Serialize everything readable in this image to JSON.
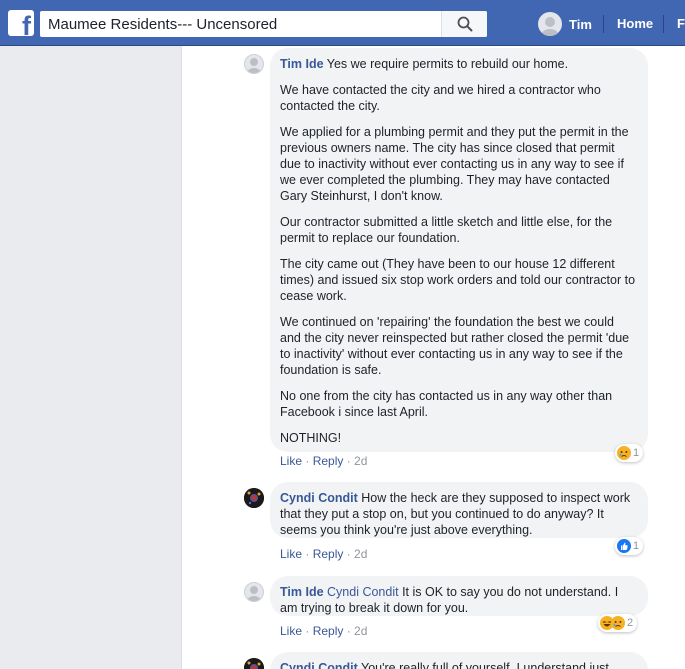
{
  "header": {
    "logo": "f",
    "search_value": "Maumee Residents--- Uncensored",
    "user_name": "Tim",
    "nav_home": "Home",
    "nav_partial": "F"
  },
  "comments": [
    {
      "author": "Tim Ide",
      "paragraphs": [
        "Yes we require permits to rebuild our home.",
        "We have contacted the city and we hired a contractor who contacted the city.",
        "We applied for a plumbing permit and they put the permit in the previous owners name. The city has since closed that permit due to inactivity without ever contacting us in any way to see if we ever completed the plumbing. They may have contacted Gary Steinhurst, I don't know.",
        "Our contractor submitted a little sketch and little else, for the permit to replace our foundation.",
        "The city came out (They have been to our house 12 different times) and issued six stop work orders and told our contractor to cease work.",
        "We continued on 'repairing' the foundation the best we could and the city never reinspected but rather closed the permit 'due to inactivity' without ever contacting us in any way to see if the foundation is safe.",
        "No one from the city has contacted us in any way other than Facebook i since last April.",
        "NOTHING!"
      ],
      "like": "Like",
      "reply": "Reply",
      "time": "2d",
      "reaction_count": "1",
      "reaction_icons": [
        "sad-icon"
      ]
    },
    {
      "author": "Cyndi Condit",
      "text": "How the heck are they supposed to inspect work that they put a stop on, but you continued to do anyway? It seems you think you're just above everything.",
      "like": "Like",
      "reply": "Reply",
      "time": "2d",
      "reaction_count": "1",
      "reaction_icons": [
        "like-icon"
      ]
    },
    {
      "author": "Tim Ide",
      "mention": "Cyndi Condit",
      "text": "It is OK to say you do not understand. I am trying to break it down for you.",
      "like": "Like",
      "reply": "Reply",
      "time": "2d",
      "reaction_count": "2",
      "reaction_icons": [
        "haha-icon",
        "sad-icon"
      ]
    },
    {
      "author": "Cyndi Condit",
      "text": "You're really full of yourself. I understand just"
    }
  ],
  "colors": {
    "topbar": "#4267b2",
    "link": "#385898",
    "bubble": "#f2f3f5",
    "background": "#e9ebee"
  }
}
